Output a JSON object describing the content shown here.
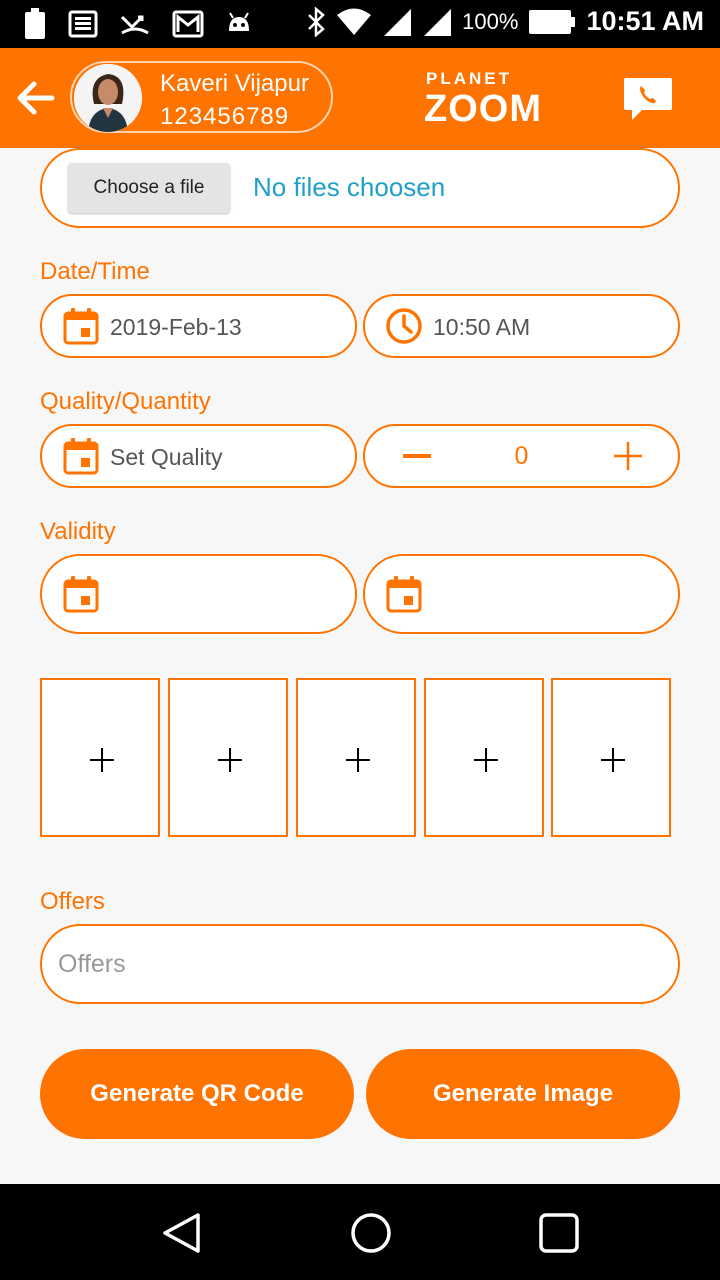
{
  "status_bar": {
    "time": "10:51 AM",
    "battery_percent": "100%",
    "icons": [
      "battery-icon",
      "news-icon",
      "missed-call-icon",
      "gmail-icon",
      "android-icon",
      "bluetooth-icon",
      "wifi-icon",
      "signal-icon"
    ]
  },
  "header": {
    "user_name": "Kaveri Vijapur",
    "user_phone": "123456789",
    "logo_top": "PLANET",
    "logo_main": "ZOOM",
    "accent_color": "#ff7300"
  },
  "file_picker": {
    "button_label": "Choose a file",
    "status": "No files choosen"
  },
  "date_time": {
    "label": "Date/Time",
    "date": "2019-Feb-13",
    "time": "10:50 AM"
  },
  "quality_quantity": {
    "label": "Quality/Quantity",
    "quality_placeholder": "Set Quality",
    "quantity": "0"
  },
  "validity": {
    "label": "Validity"
  },
  "image_slots": 5,
  "offers": {
    "label": "Offers",
    "placeholder": "Offers"
  },
  "actions": {
    "generate_qr": "Generate QR Code",
    "generate_image": "Generate Image"
  }
}
